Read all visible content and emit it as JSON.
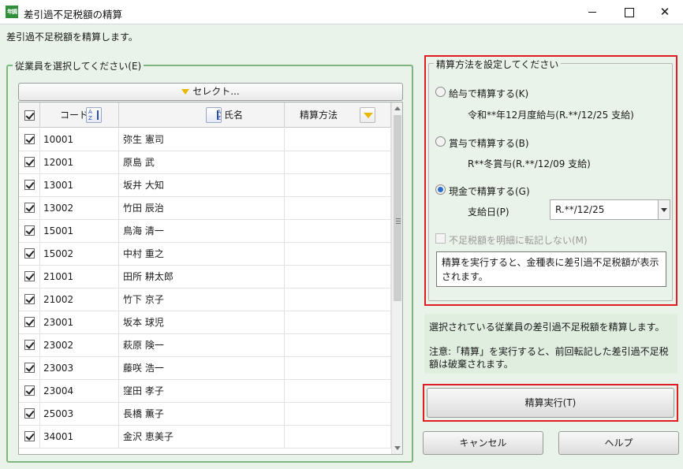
{
  "window": {
    "app_icon_text": "年調",
    "title": "差引過不足税額の精算",
    "minimize_glyph": "",
    "maximize_glyph": "",
    "close_glyph": "✕"
  },
  "description": "差引過不足税額を精算します。",
  "employee_group": {
    "legend": "従業員を選択してください(E)",
    "select_button": "セレクト...",
    "columns": {
      "code": "コード",
      "name": "氏名",
      "method": "精算方法"
    },
    "rows": [
      {
        "code": "10001",
        "name": "弥生 憲司",
        "method": "",
        "checked": true
      },
      {
        "code": "12001",
        "name": "原島 武",
        "method": "",
        "checked": true
      },
      {
        "code": "13001",
        "name": "坂井 大知",
        "method": "",
        "checked": true
      },
      {
        "code": "13002",
        "name": "竹田 辰治",
        "method": "",
        "checked": true
      },
      {
        "code": "15001",
        "name": "鳥海 清一",
        "method": "",
        "checked": true
      },
      {
        "code": "15002",
        "name": "中村 重之",
        "method": "",
        "checked": true
      },
      {
        "code": "21001",
        "name": "田所 耕太郎",
        "method": "",
        "checked": true
      },
      {
        "code": "21002",
        "name": "竹下 京子",
        "method": "",
        "checked": true
      },
      {
        "code": "23001",
        "name": "坂本 球児",
        "method": "",
        "checked": true
      },
      {
        "code": "23002",
        "name": "萩原 険一",
        "method": "",
        "checked": true
      },
      {
        "code": "23003",
        "name": "藤咲 浩一",
        "method": "",
        "checked": true
      },
      {
        "code": "23004",
        "name": "窪田 孝子",
        "method": "",
        "checked": true
      },
      {
        "code": "25003",
        "name": "長橋 薫子",
        "method": "",
        "checked": true
      },
      {
        "code": "34001",
        "name": "金沢 恵美子",
        "method": "",
        "checked": true
      }
    ]
  },
  "settings_group": {
    "legend": "精算方法を設定してください",
    "opt_salary": "給与で精算する(K)",
    "opt_salary_detail": "令和**年12月度給与(R.**/12/25 支給)",
    "opt_bonus": "賞与で精算する(B)",
    "opt_bonus_detail": "R**冬賞与(R.**/12/09 支給)",
    "opt_cash": "現金で精算する(G)",
    "selected": "cash",
    "pay_date_label": "支給日(P)",
    "pay_date_value": "R.**/12/25",
    "no_transfer_label": "不足税額を明細に転記しない(M)",
    "note": "精算を実行すると、金種表に差引過不足税額が表示されます。"
  },
  "info": {
    "line1": "選択されている従業員の差引過不足税額を精算します。",
    "line2": "注意:「精算」を実行すると、前回転記した差引過不足税額は破棄されます。"
  },
  "buttons": {
    "run": "精算実行(T)",
    "cancel": "キャンセル",
    "help": "ヘルプ"
  },
  "colors": {
    "highlight_frame": "#e21c23",
    "group_border": "#7fb57f",
    "background": "#eaf3ea"
  }
}
